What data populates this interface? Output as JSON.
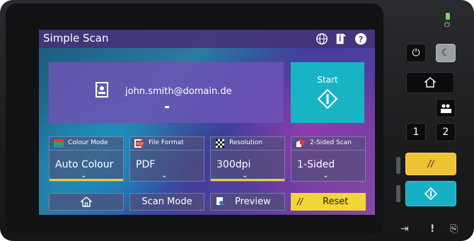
{
  "screen": {
    "title": "Simple Scan",
    "user": {
      "email": "john.smith@domain.de",
      "dash": "-"
    },
    "start": {
      "label": "Start"
    },
    "tiles": [
      {
        "header": "Colour Mode",
        "value": "Auto Colour",
        "icon": "colour-mode-icon"
      },
      {
        "header": "File Format",
        "value": "PDF",
        "icon": "file-format-icon"
      },
      {
        "header": "Resolution",
        "value": "300dpi",
        "icon": "resolution-icon"
      },
      {
        "header": "2-Sided Scan",
        "value": "1-Sided",
        "icon": "two-sided-scan-icon"
      }
    ],
    "buttons": {
      "home": "",
      "scan_mode": "Scan Mode",
      "preview": "Preview",
      "reset": "Reset"
    }
  },
  "panel": {
    "one": "1",
    "two": "2"
  },
  "colors": {
    "start_teal": "#19b3c6",
    "reset_yellow": "#f3d536",
    "tile_bar": "#e4d23a"
  }
}
